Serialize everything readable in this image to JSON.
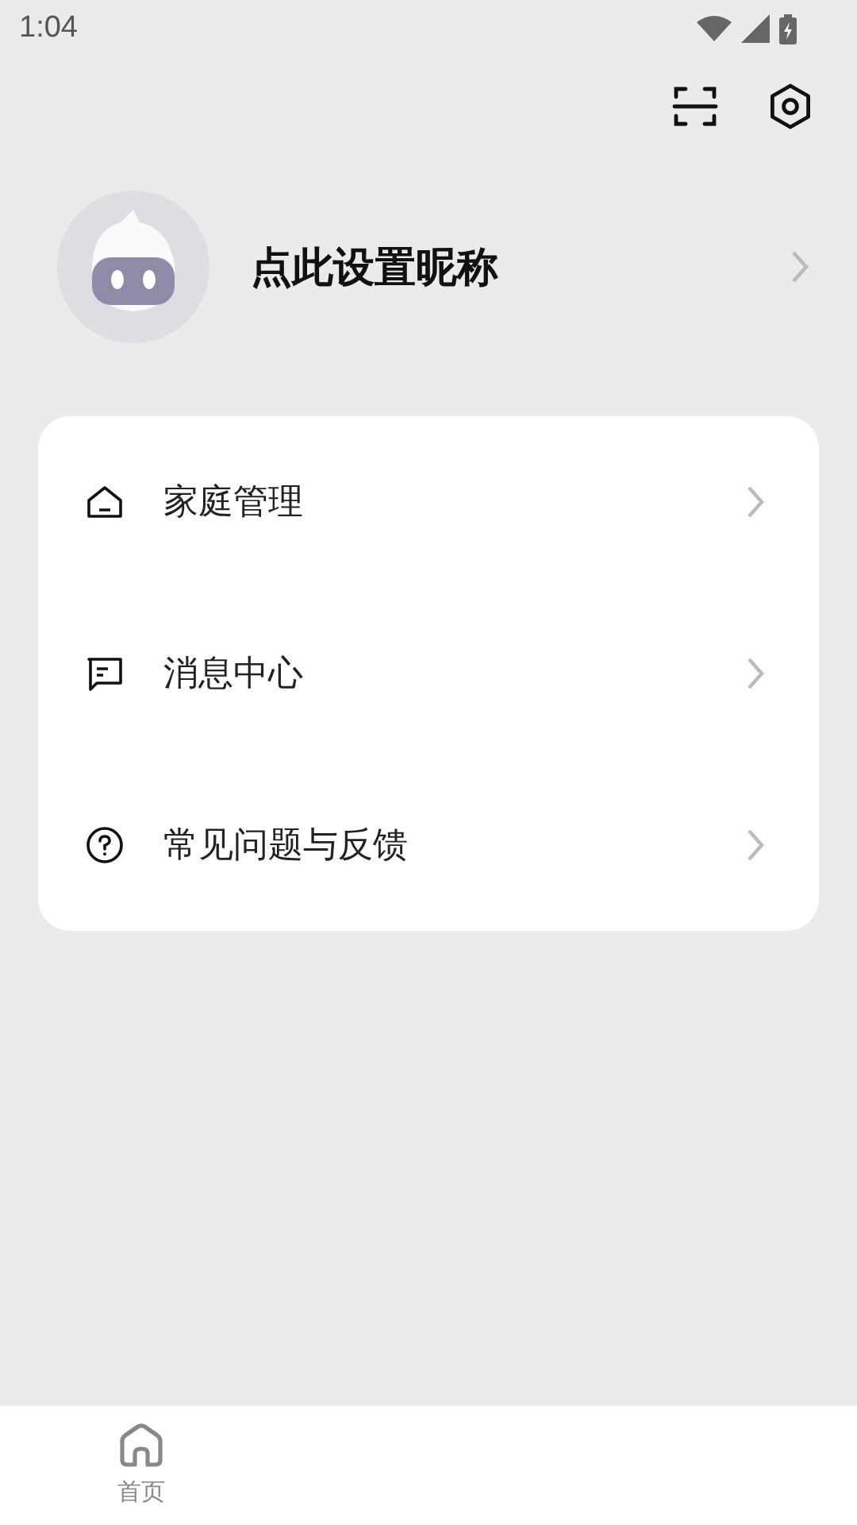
{
  "status_bar": {
    "time": "1:04"
  },
  "profile": {
    "nickname": "点此设置昵称"
  },
  "menu": [
    {
      "kind": "home",
      "label": "家庭管理"
    },
    {
      "kind": "message",
      "label": "消息中心"
    },
    {
      "kind": "help",
      "label": "常见问题与反馈"
    }
  ],
  "bottom_nav": [
    {
      "kind": "home",
      "label": "首页",
      "selected": false
    }
  ]
}
